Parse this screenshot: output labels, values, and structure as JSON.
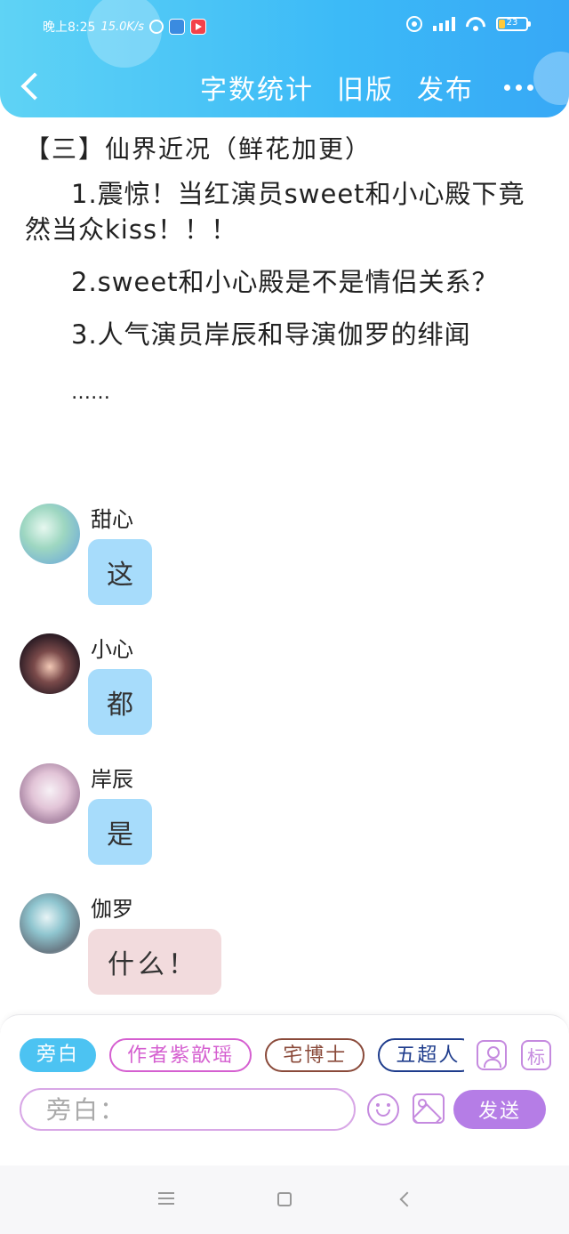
{
  "status_bar": {
    "time": "晚上8:25",
    "net_speed": "15.0K/s",
    "battery": "23"
  },
  "header": {
    "word_count": "字数统计",
    "old_version": "旧版",
    "publish": "发布",
    "accent_color": "#3cbaf7"
  },
  "article": {
    "title": "【三】仙界近况（鲜花加更）",
    "paragraphs": [
      "1.震惊！当红演员sweet和小心殿下竟然当众kiss！！！",
      "2.sweet和小心殿是不是情侣关系？",
      "3.人气演员岸辰和导演伽罗的绯闻"
    ],
    "ellipsis": "……"
  },
  "messages": [
    {
      "sender": "甜心",
      "text": "这"
    },
    {
      "sender": "小心",
      "text": "都"
    },
    {
      "sender": "岸辰",
      "text": "是"
    },
    {
      "sender": "伽罗",
      "text": "什么！"
    }
  ],
  "composer": {
    "chips": [
      "旁白",
      "作者紫歆瑶",
      "宅博士",
      "五超人"
    ],
    "mark_label": "标",
    "input_placeholder": "旁白：",
    "send_label": "发送"
  }
}
